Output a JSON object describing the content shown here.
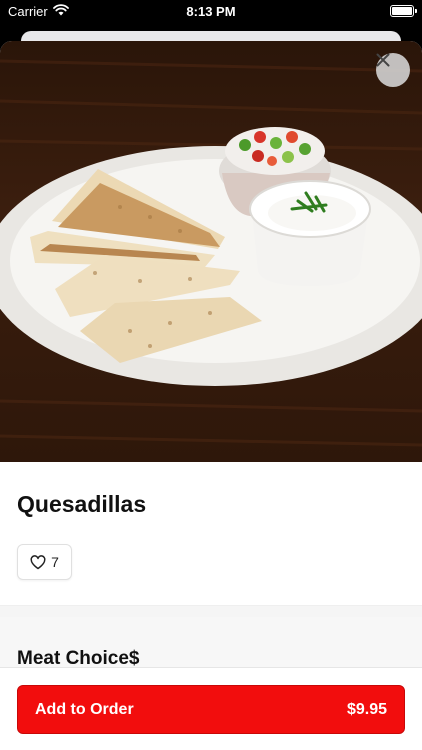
{
  "status_bar": {
    "carrier": "Carrier",
    "time": "8:13 PM",
    "wifi_icon": "wifi-icon",
    "battery_icon": "battery-icon",
    "battery_level": 1.0
  },
  "item": {
    "photo_description_icon": "quesadilla-plate-photo",
    "title": "Quesadillas",
    "likes": "7"
  },
  "section": {
    "heading": "Meat Choice$"
  },
  "footer": {
    "add_label": "Add to Order",
    "price": "$9.95"
  },
  "colors": {
    "accent": "#f20d0d",
    "status_bar": "#000000"
  }
}
